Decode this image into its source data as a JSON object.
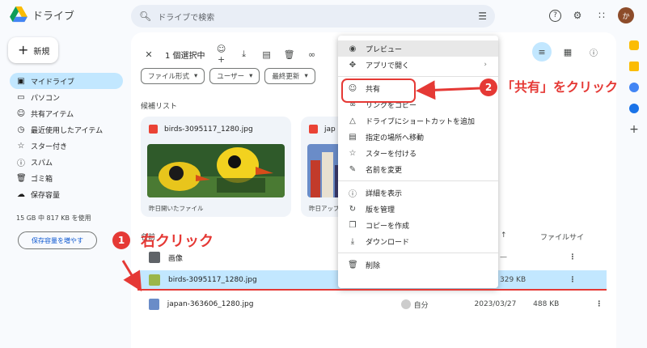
{
  "header": {
    "app_name": "ドライブ",
    "search_placeholder": "ドライブで検索",
    "avatar_letter": "か"
  },
  "sidebar": {
    "new_label": "新規",
    "items": [
      {
        "label": "マイドライブ",
        "icon": "my-drive-icon"
      },
      {
        "label": "パソコン",
        "icon": "computer-icon"
      },
      {
        "label": "共有アイテム",
        "icon": "shared-icon"
      },
      {
        "label": "最近使用したアイテム",
        "icon": "recent-icon"
      },
      {
        "label": "スター付き",
        "icon": "star-icon"
      },
      {
        "label": "スパム",
        "icon": "spam-icon"
      },
      {
        "label": "ゴミ箱",
        "icon": "trash-icon"
      },
      {
        "label": "保存容量",
        "icon": "cloud-icon"
      }
    ],
    "storage_text": "15 GB 中 817 KB を使用",
    "storage_button": "保存容量を増やす"
  },
  "toolbar": {
    "selected_text": "1 個選択中"
  },
  "filters": {
    "file_type": "ファイル形式",
    "user": "ユーザー",
    "last_modified": "最終更新"
  },
  "candidates": {
    "label": "候補リスト",
    "cards": [
      {
        "title": "birds-3095117_1280.jpg",
        "footer": "昨日開いたファイル"
      },
      {
        "title": "jap",
        "footer": "昨日アップ"
      }
    ]
  },
  "list": {
    "col_name": "名前",
    "col_size": "ファイルサイ",
    "rows": [
      {
        "name": "画像",
        "owner": "",
        "date": "7",
        "size": "—"
      },
      {
        "name": "birds-3095117_1280.jpg",
        "owner": "",
        "date": "7",
        "size": "329 KB"
      },
      {
        "name": "japan-363606_1280.jpg",
        "owner": "自分",
        "date": "2023/03/27",
        "size": "488 KB"
      }
    ]
  },
  "context_menu": {
    "items": [
      {
        "label": "プレビュー",
        "icon": "eye-icon"
      },
      {
        "label": "アプリで開く",
        "icon": "open-with-icon"
      },
      {
        "label": "共有",
        "icon": "share-person-icon"
      },
      {
        "label": "リンクをコピー",
        "icon": "link-icon"
      },
      {
        "label": "ドライブにショートカットを追加",
        "icon": "add-shortcut-icon"
      },
      {
        "label": "指定の場所へ移動",
        "icon": "move-icon"
      },
      {
        "label": "スターを付ける",
        "icon": "star-outline-icon"
      },
      {
        "label": "名前を変更",
        "icon": "rename-icon"
      },
      {
        "label": "詳細を表示",
        "icon": "info-icon"
      },
      {
        "label": "版を管理",
        "icon": "versions-icon"
      },
      {
        "label": "コピーを作成",
        "icon": "copy-icon"
      },
      {
        "label": "ダウンロード",
        "icon": "download-icon"
      },
      {
        "label": "削除",
        "icon": "delete-icon"
      }
    ]
  },
  "annotations": {
    "step1_num": "1",
    "step1_text": "右クリック",
    "step2_num": "2",
    "step2_text": "「共有」をクリック"
  },
  "colors": {
    "accent_red": "#e53935",
    "selected_blue": "#c2e7ff",
    "link_blue": "#0b57d0"
  }
}
